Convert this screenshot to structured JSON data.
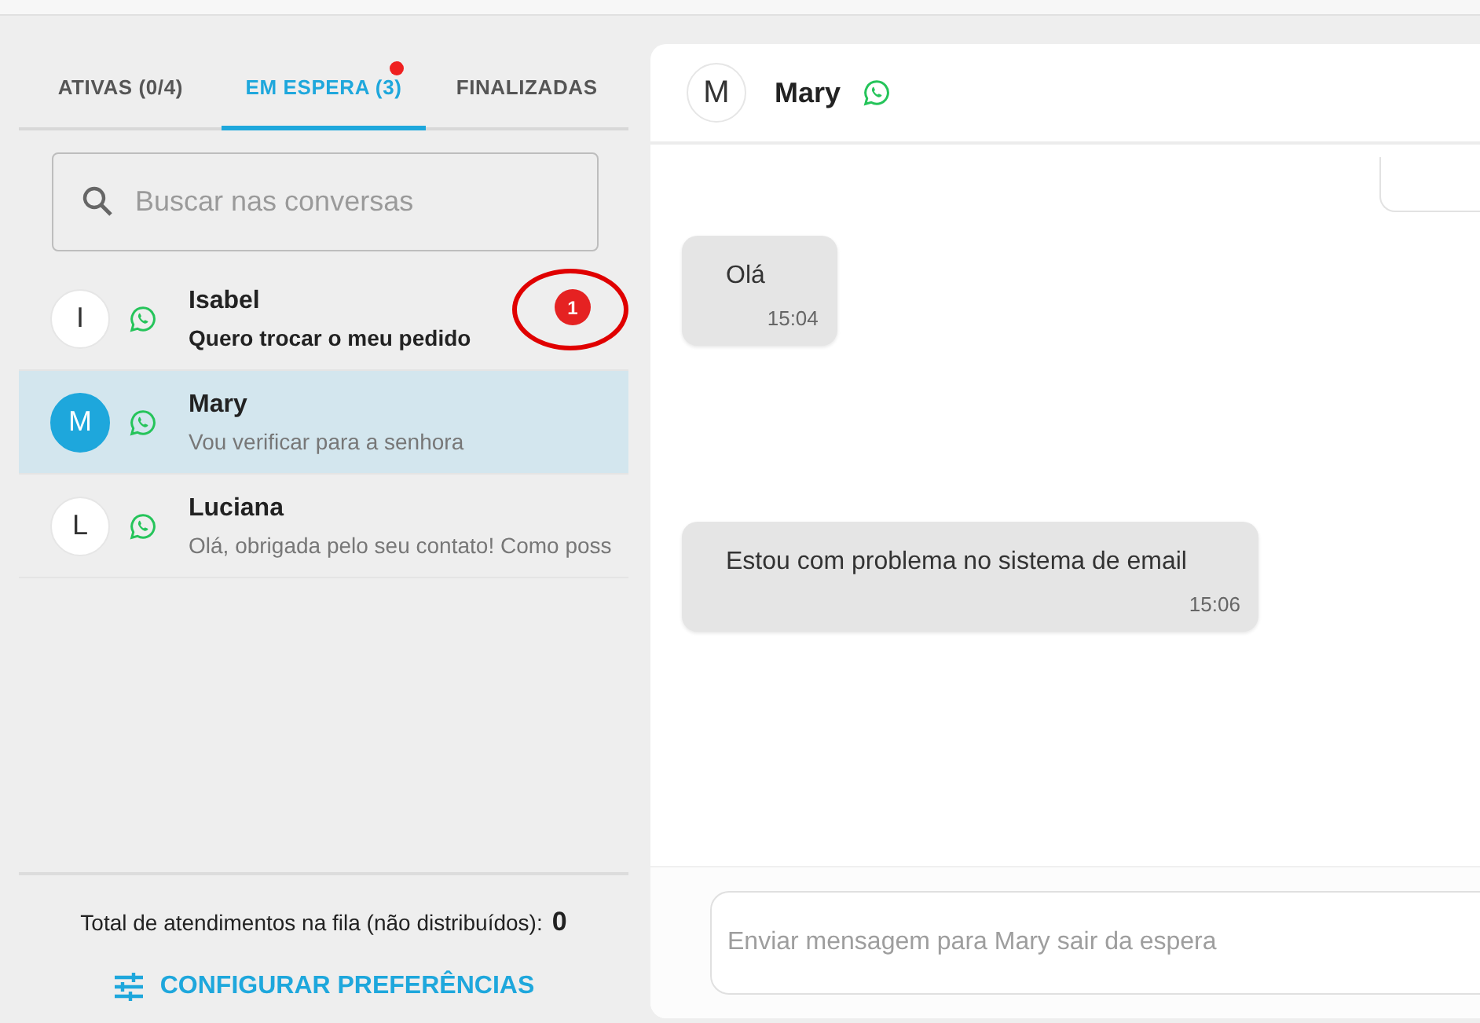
{
  "tabs": [
    {
      "label": "ATIVAS (0/4)",
      "selected": false,
      "dot": false
    },
    {
      "label": "EM ESPERA (3)",
      "selected": true,
      "dot": true
    },
    {
      "label": "FINALIZADAS",
      "selected": false,
      "dot": false
    }
  ],
  "search": {
    "placeholder": "Buscar nas conversas"
  },
  "conversations": [
    {
      "initial": "I",
      "name": "Isabel",
      "preview": "Quero trocar o meu pedido",
      "unread": "1",
      "bold_preview": true,
      "selected": false,
      "highlighted": true
    },
    {
      "initial": "M",
      "name": "Mary",
      "preview": "Vou verificar para a senhora",
      "bold_preview": false,
      "selected": true,
      "highlighted": false
    },
    {
      "initial": "L",
      "name": "Luciana",
      "preview": "Olá, obrigada pelo seu contato! Como poss",
      "bold_preview": false,
      "selected": false,
      "highlighted": false
    }
  ],
  "queue": {
    "label": "Total de atendimentos na fila (não distribuídos):",
    "count": "0"
  },
  "preferences_button": "CONFIGURAR PREFERÊNCIAS",
  "chat": {
    "initial": "M",
    "name": "Mary",
    "messages": [
      {
        "text": "Olá",
        "time": "15:04"
      },
      {
        "text": "Estou com problema no sistema de email",
        "time": "15:06"
      }
    ],
    "composer_placeholder": "Enviar mensagem para Mary sair da espera"
  }
}
